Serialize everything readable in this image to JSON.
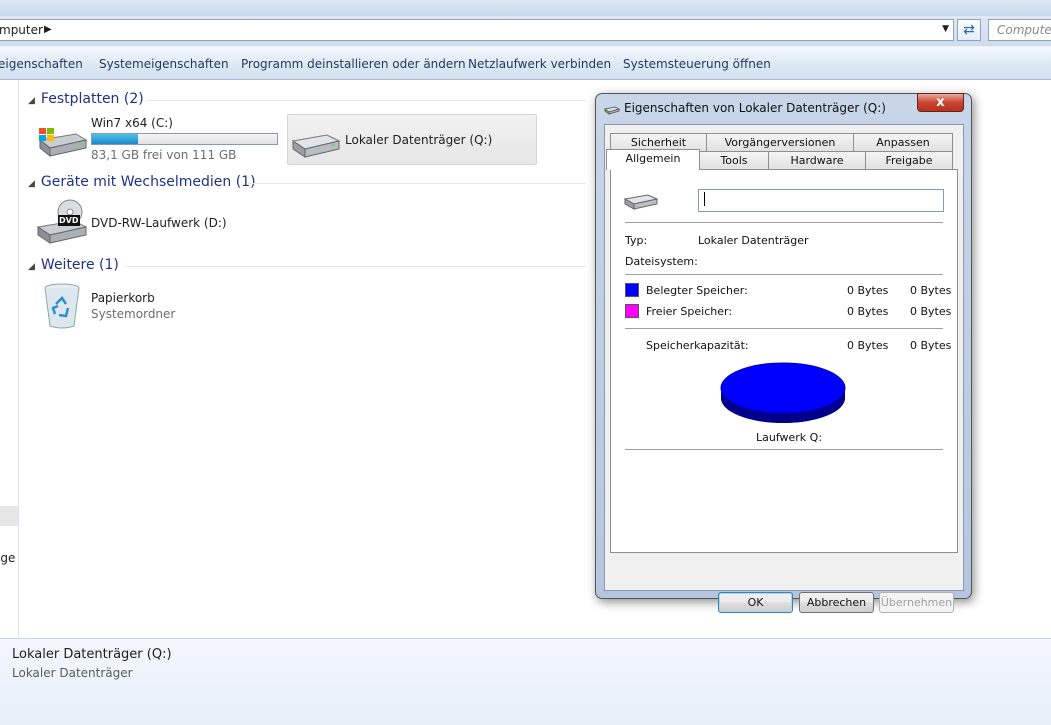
{
  "address": {
    "path": "mputer",
    "search_placeholder": "Computer"
  },
  "commands": [
    "eigenschaften",
    "Systemeigenschaften",
    "Programm deinstallieren oder ändern",
    "Netzlaufwerk verbinden",
    "Systemsteuerung öffnen"
  ],
  "nav": {
    "truncated_label": "ige"
  },
  "groups": {
    "festplatten": "Festplatten (2)",
    "wechsel": "Geräte mit Wechselmedien (1)",
    "weitere": "Weitere (1)"
  },
  "drives": {
    "c": {
      "name": "Win7 x64 (C:)",
      "free": "83,1 GB frei von 111 GB",
      "used_fraction": 0.25
    },
    "q": {
      "name": "Lokaler Datenträger (Q:)"
    },
    "d": {
      "name": "DVD-RW-Laufwerk (D:)",
      "badge": "DVD"
    },
    "bin": {
      "name": "Papierkorb",
      "sub": "Systemordner"
    }
  },
  "details": {
    "title": "Lokaler Datenträger (Q:)",
    "subtitle": "Lokaler Datenträger"
  },
  "dialog": {
    "title": "Eigenschaften von Lokaler Datenträger (Q:)",
    "close": "x",
    "tabs_back": [
      "Sicherheit",
      "Vorgängerversionen",
      "Anpassen"
    ],
    "tabs_front": [
      "Allgemein",
      "Tools",
      "Hardware",
      "Freigabe"
    ],
    "name_value": "",
    "typ_label": "Typ:",
    "typ_value": "Lokaler Datenträger",
    "fs_label": "Dateisystem:",
    "used_label": "Belegter Speicher:",
    "used_bytes1": "0 Bytes",
    "used_bytes2": "0 Bytes",
    "free_label": "Freier Speicher:",
    "free_bytes1": "0 Bytes",
    "free_bytes2": "0 Bytes",
    "cap_label": "Speicherkapazität:",
    "cap_bytes1": "0 Bytes",
    "cap_bytes2": "0 Bytes",
    "drive_label": "Laufwerk Q:",
    "used_color": "#0000ff",
    "free_color": "#ff00ff",
    "ok": "OK",
    "cancel": "Abbrechen",
    "apply": "Übernehmen"
  }
}
